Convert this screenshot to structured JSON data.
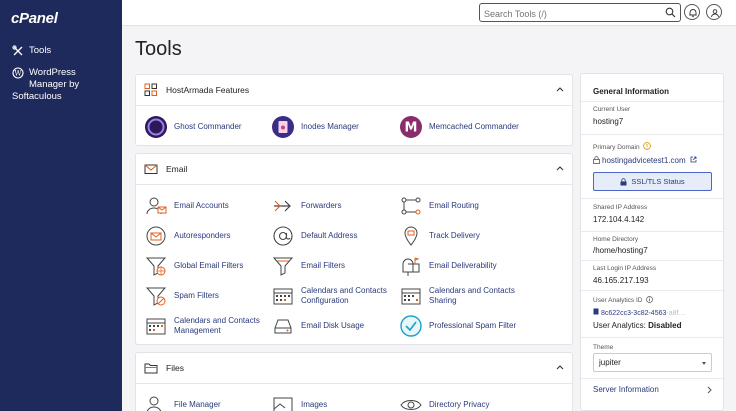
{
  "app": {
    "logo": "cPanel"
  },
  "sidebar": {
    "items": [
      {
        "label": "Tools"
      },
      {
        "label": "WordPress Manager by",
        "label_cont": "Softaculous"
      }
    ]
  },
  "header": {
    "search_placeholder": "Search Tools (/)"
  },
  "page": {
    "title": "Tools"
  },
  "panels": {
    "hostarmada": {
      "title": "HostArmada Features",
      "tools": [
        {
          "label": "Ghost Commander"
        },
        {
          "label": "Inodes Manager"
        },
        {
          "label": "Memcached Commander"
        }
      ]
    },
    "email": {
      "title": "Email",
      "tools": [
        {
          "label": "Email Accounts"
        },
        {
          "label": "Forwarders"
        },
        {
          "label": "Email Routing"
        },
        {
          "label": "Autoresponders"
        },
        {
          "label": "Default Address"
        },
        {
          "label": "Track Delivery"
        },
        {
          "label": "Global Email Filters"
        },
        {
          "label": "Email Filters"
        },
        {
          "label": "Email Deliverability"
        },
        {
          "label": "Spam Filters"
        },
        {
          "label": "Calendars and Contacts",
          "label2": "Configuration"
        },
        {
          "label": "Calendars and Contacts",
          "label2": "Sharing"
        },
        {
          "label": "Calendars and Contacts",
          "label2": "Management"
        },
        {
          "label": "Email Disk Usage"
        },
        {
          "label": "Professional Spam Filter"
        }
      ]
    },
    "files": {
      "title": "Files",
      "tools": [
        {
          "label": "File Manager"
        },
        {
          "label": "Images"
        },
        {
          "label": "Directory Privacy"
        }
      ]
    }
  },
  "general": {
    "title": "General Information",
    "current_user_label": "Current User",
    "current_user": "hosting7",
    "primary_domain_label": "Primary Domain",
    "primary_domain": "hostingadvicetest1.com",
    "ssl_button": "SSL/TLS Status",
    "shared_ip_label": "Shared IP Address",
    "shared_ip": "172.104.4.142",
    "home_dir_label": "Home Directory",
    "home_dir": "/home/hosting7",
    "last_login_label": "Last Login IP Address",
    "last_login": "46.165.217.193",
    "analytics_id_label": "User Analytics ID",
    "analytics_id": "8c622cc3-3c82-4563",
    "analytics_status_label": "User Analytics:",
    "analytics_status": "Disabled",
    "theme_label": "Theme",
    "theme_value": "jupiter",
    "server_info": "Server Information"
  },
  "colors": {
    "sidebar": "#1f2a5c",
    "link": "#2a3a7c",
    "accent": "#4b65c8"
  }
}
